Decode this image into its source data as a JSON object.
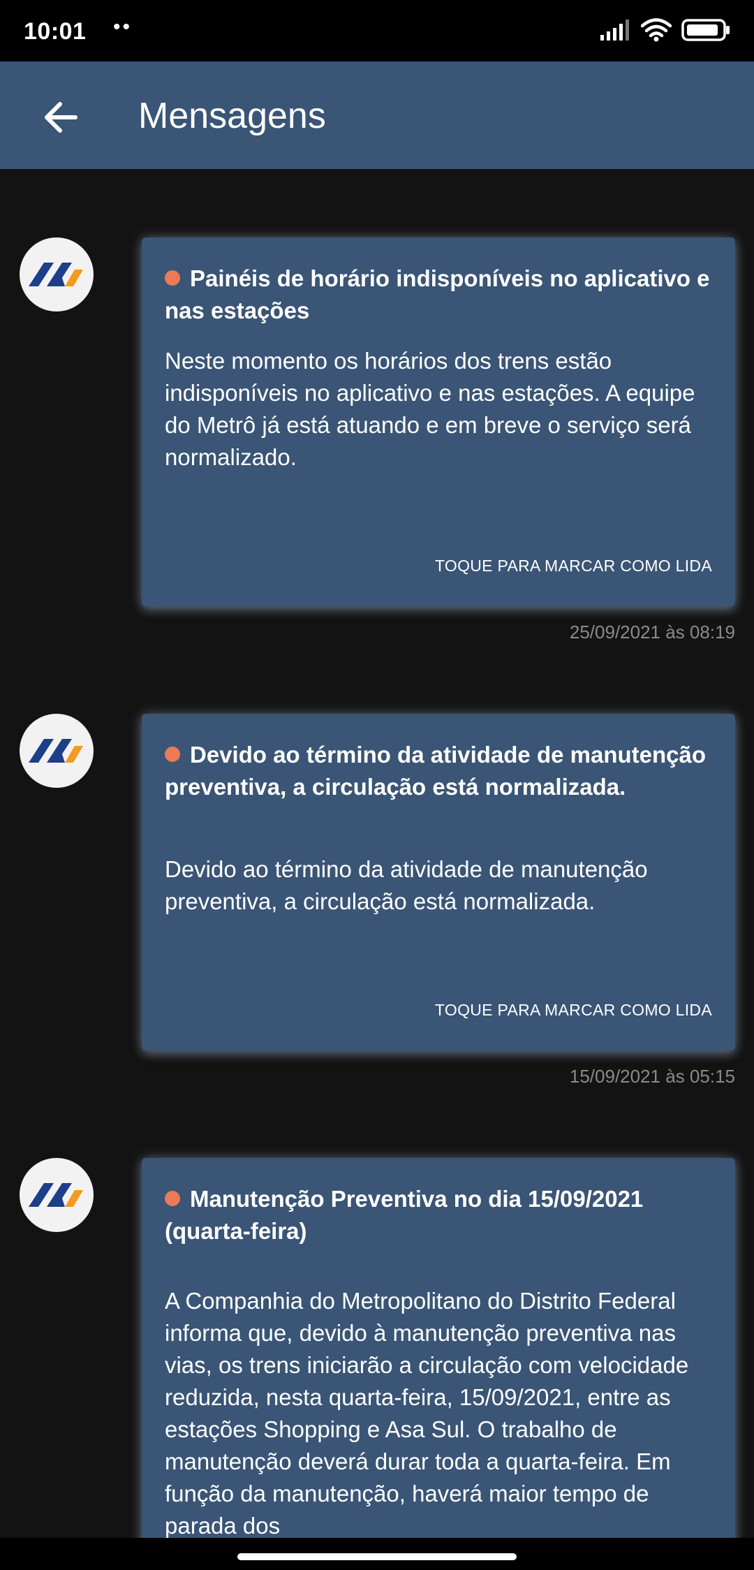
{
  "status_bar": {
    "time": "10:01",
    "notification_dots": "••",
    "icons": [
      "signal-icon",
      "wifi-icon",
      "battery-icon"
    ]
  },
  "app_bar": {
    "title": "Mensagens",
    "back_icon": "arrow-left-icon"
  },
  "colors": {
    "app_bar": "#3a5575",
    "card": "#3a5575",
    "background": "#131313",
    "unread_dot": "#ec7b55",
    "logo_blue": "#1d3f8a",
    "logo_orange": "#f39a1f"
  },
  "messages": [
    {
      "title": "Painéis de horário indisponíveis no aplicativo e nas estações",
      "body": "Neste momento os horários dos trens estão indisponíveis no aplicativo e nas estações. A equipe do Metrô já está atuando e em breve o serviço será normalizado.",
      "action": "TOQUE PARA MARCAR COMO LIDA",
      "date": "25/09/2021 às 08:19"
    },
    {
      "title": "Devido ao término da atividade de manutenção preventiva, a circulação está normalizada.",
      "body": "Devido ao término da atividade de manutenção preventiva, a circulação está normalizada.",
      "action": "TOQUE PARA MARCAR COMO LIDA",
      "date": "15/09/2021 às 05:15"
    },
    {
      "title": "Manutenção Preventiva no dia 15/09/2021 (quarta-feira)",
      "body": "A Companhia do Metropolitano do Distrito Federal informa que, devido à manutenção preventiva nas vias, os trens iniciarão a circulação com velocidade reduzida, nesta quarta-feira, 15/09/2021, entre as estações Shopping e Asa Sul. O trabalho de manutenção deverá durar toda a quarta-feira. Em função da manutenção, haverá maior tempo de parada dos"
    }
  ]
}
